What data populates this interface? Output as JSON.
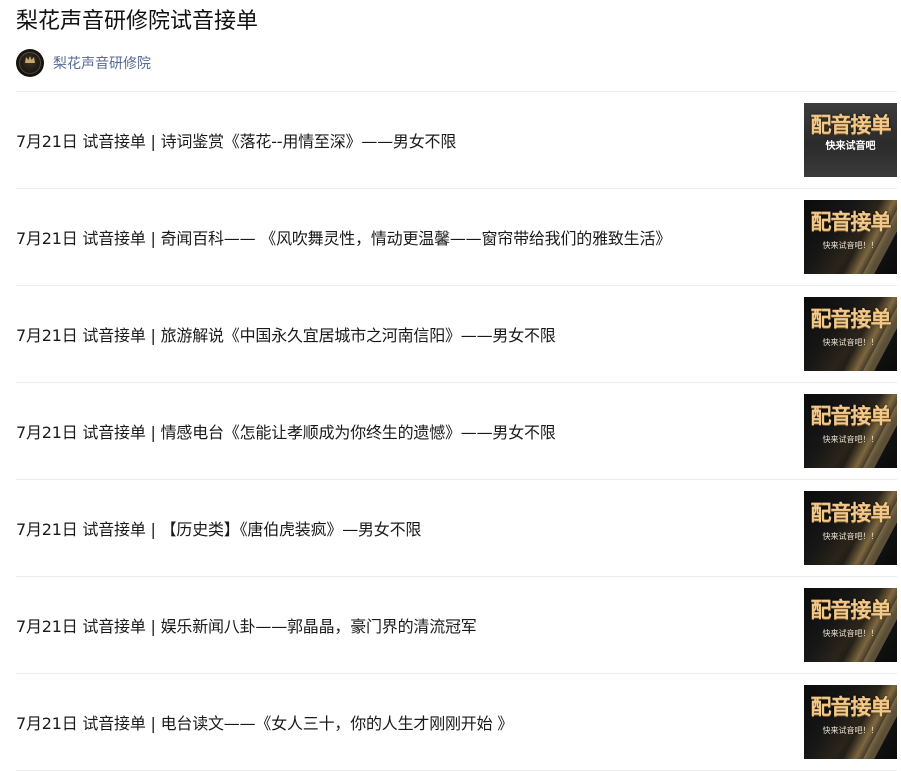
{
  "album": {
    "title": "梨花声音研修院试音接单",
    "author": "梨花声音研修院"
  },
  "icons": {
    "avatar": "brand-logo-avatar"
  },
  "colors": {
    "author_link": "#576b95",
    "thumb_gold": "#f3c98b",
    "divider": "#ececec"
  },
  "articles": [
    {
      "title": "7月21日 试音接单 | 诗词鉴赏《落花--用情至深》——男女不限",
      "thumb_title": "配音接单",
      "thumb_sub": "快来试音吧",
      "thumb_style": "gray"
    },
    {
      "title": "7月21日 试音接单 | 奇闻百科—— 《风吹舞灵性，情动更温馨——窗帘带给我们的雅致生活》",
      "thumb_title": "配音接单",
      "thumb_sub": "快来试音吧！！",
      "thumb_style": "gold"
    },
    {
      "title": "7月21日 试音接单 | 旅游解说《中国永久宜居城市之河南信阳》——男女不限",
      "thumb_title": "配音接单",
      "thumb_sub": "快来试音吧！！",
      "thumb_style": "gold"
    },
    {
      "title": "7月21日 试音接单 | 情感电台《怎能让孝顺成为你终生的遗憾》——男女不限",
      "thumb_title": "配音接单",
      "thumb_sub": "快来试音吧！！",
      "thumb_style": "gold"
    },
    {
      "title": "7月21日 试音接单 | 【历史类】《唐伯虎装疯》—男女不限",
      "thumb_title": "配音接单",
      "thumb_sub": "快来试音吧！！",
      "thumb_style": "gold"
    },
    {
      "title": "7月21日 试音接单 | 娱乐新闻八卦——郭晶晶，豪门界的清流冠军",
      "thumb_title": "配音接单",
      "thumb_sub": "快来试音吧！！",
      "thumb_style": "gold"
    },
    {
      "title": "7月21日 试音接单 | 电台读文——《女人三十，你的人生才刚刚开始 》",
      "thumb_title": "配音接单",
      "thumb_sub": "快来试音吧！！",
      "thumb_style": "gold"
    }
  ]
}
